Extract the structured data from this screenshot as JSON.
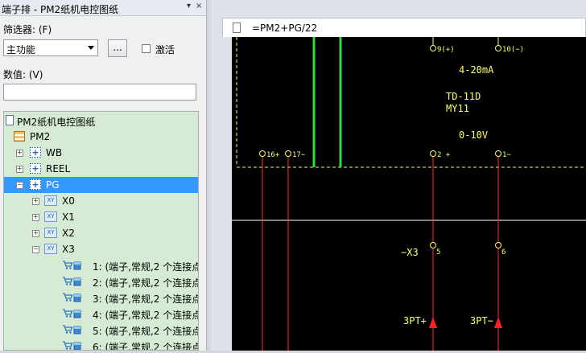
{
  "panel": {
    "title": "端子排 - PM2纸机电控图纸",
    "pin_icon": "▾",
    "close_icon": "×",
    "filter_label": "筛选器: (F)",
    "filter_value": "主功能",
    "browse_label": "...",
    "activate_label": "激活",
    "value_label": "数值: (V)",
    "value_input": ""
  },
  "tree": {
    "root": "PM2纸机电控图纸",
    "pm2": "PM2",
    "wb": "WB",
    "reel": "REEL",
    "pg": "PG",
    "x0": "X0",
    "x1": "X1",
    "x2": "X2",
    "x3": "X3",
    "xy_badge": "XY",
    "terminals": [
      "1: (端子,常规,2 个连接点",
      "2: (端子,常规,2 个连接点",
      "3: (端子,常规,2 个连接点",
      "4: (端子,常规,2 个连接点",
      "5: (端子,常规,2 个连接点",
      "6: (端子,常规,2 个连接点"
    ]
  },
  "document": {
    "tab_title": "=PM2+PG/22"
  },
  "drawing": {
    "top_pin_9": "9(+)",
    "top_pin_10": "10(−)",
    "signal_a": "4-20mA",
    "device": "TD-11D",
    "device_id": "MY11",
    "signal_v": "0-10V",
    "pin_16": "16+",
    "pin_17": "17−",
    "pin_2": "2 +",
    "pin_1": "1−",
    "connector": "−X3",
    "pin_5": "5",
    "pin_6": "6",
    "out_plus": "3PT+",
    "out_minus": "3PT−",
    "colors": {
      "wire_green": "#33dd33",
      "wire_red": "#ff3030",
      "text_yellow": "#ffff66",
      "grid_white": "#ffffff"
    }
  }
}
